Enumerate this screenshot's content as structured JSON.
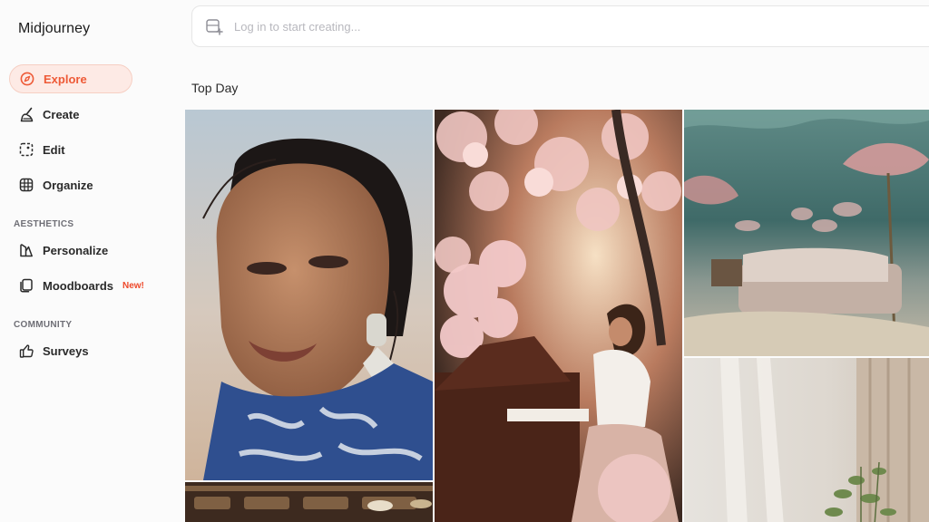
{
  "app": {
    "brand": "Midjourney"
  },
  "sidebar": {
    "items": [
      {
        "label": "Explore",
        "icon": "compass-icon",
        "active": true
      },
      {
        "label": "Create",
        "icon": "brush-icon"
      },
      {
        "label": "Edit",
        "icon": "edit-frame-icon"
      },
      {
        "label": "Organize",
        "icon": "grid-icon"
      }
    ],
    "sections": [
      {
        "label": "AESTHETICS",
        "items": [
          {
            "label": "Personalize",
            "icon": "personalize-icon"
          },
          {
            "label": "Moodboards",
            "icon": "moodboard-icon",
            "badge": "New!"
          }
        ]
      },
      {
        "label": "COMMUNITY",
        "items": [
          {
            "label": "Surveys",
            "icon": "thumbs-up-icon"
          }
        ]
      }
    ]
  },
  "search": {
    "placeholder": "Log in to start creating..."
  },
  "main": {
    "section_title": "Top Day",
    "gallery": [
      {
        "name": "portrait-woman-image",
        "icon": "image"
      },
      {
        "name": "cherry-blossom-piano-image",
        "icon": "image"
      },
      {
        "name": "underwater-bedroom-image",
        "icon": "image"
      },
      {
        "name": "sunlit-room-curtain-image",
        "icon": "image"
      },
      {
        "name": "ornate-ceiling-image",
        "icon": "image"
      }
    ]
  },
  "colors": {
    "accent": "#ee5a37",
    "accent_bg": "#fdeae5",
    "badge": "#ee4a2c"
  }
}
